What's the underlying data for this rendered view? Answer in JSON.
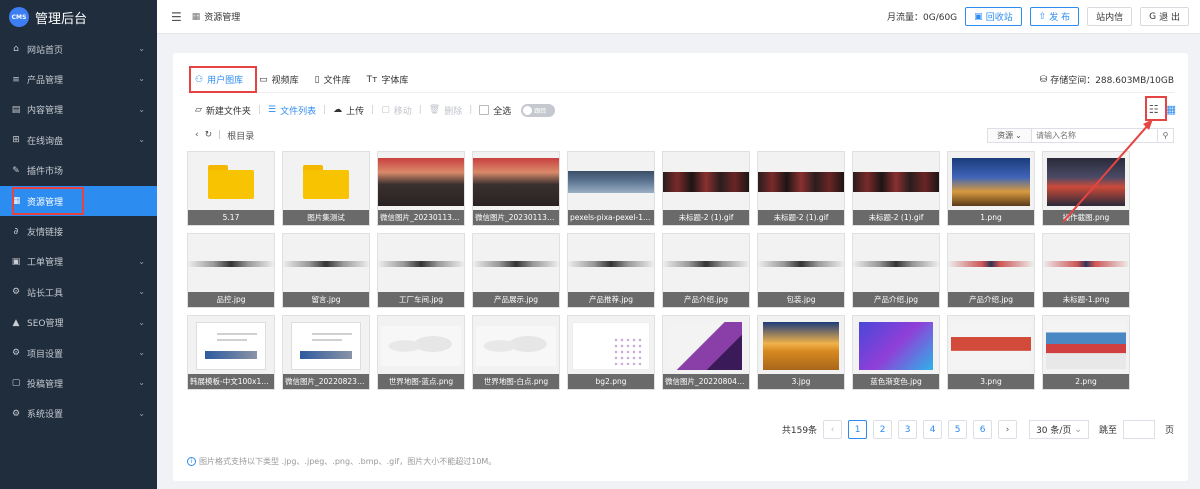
{
  "sidebar": {
    "logo_badge": "CMS",
    "logo_text": "管理后台",
    "items": [
      {
        "label": "网站首页",
        "icon": "home-icon",
        "chev": "⌄"
      },
      {
        "label": "产品管理",
        "icon": "list-icon",
        "chev": "⌄"
      },
      {
        "label": "内容管理",
        "icon": "document-icon",
        "chev": "⌄"
      },
      {
        "label": "在线询盘",
        "icon": "inquiry-icon",
        "chev": "⌄"
      },
      {
        "label": "插件市场",
        "icon": "plugin-icon",
        "chev": ""
      },
      {
        "label": "资源管理",
        "icon": "resource-icon",
        "chev": "",
        "active": true
      },
      {
        "label": "友情链接",
        "icon": "link-icon",
        "chev": ""
      },
      {
        "label": "工单管理",
        "icon": "ticket-icon",
        "chev": "⌄"
      },
      {
        "label": "站长工具",
        "icon": "tools-icon",
        "chev": "⌄"
      },
      {
        "label": "SEO管理",
        "icon": "seo-icon",
        "chev": "⌄"
      },
      {
        "label": "项目设置",
        "icon": "settings-icon",
        "chev": "⌄"
      },
      {
        "label": "投稿管理",
        "icon": "submission-icon",
        "chev": "⌄"
      },
      {
        "label": "系统设置",
        "icon": "gear-icon",
        "chev": "⌄"
      }
    ]
  },
  "topbar": {
    "breadcrumb": "资源管理",
    "traffic": "月流量：0G/60G",
    "recycle_label": "回收站",
    "publish_label": "发 布",
    "messages_label": "站内信",
    "logout_label": "退 出"
  },
  "tabs": [
    {
      "label": "用户图库",
      "icon": "user-icon"
    },
    {
      "label": "视频库",
      "icon": "video-icon"
    },
    {
      "label": "文件库",
      "icon": "file-icon"
    },
    {
      "label": "字体库",
      "icon": "font-icon"
    }
  ],
  "storage": "存储空间：288.603MB/10GB",
  "toolbar": {
    "new_folder": "新建文件夹",
    "file_list": "文件列表",
    "upload": "上传",
    "move": "移动",
    "delete": "删除",
    "select_all": "全选",
    "switch_text": "跟踪"
  },
  "path": {
    "root": "根目录"
  },
  "search": {
    "select": "资源",
    "placeholder": "请输入名称"
  },
  "files": [
    {
      "name": "5.17",
      "kind": "folder"
    },
    {
      "name": "图片集测试",
      "kind": "folder"
    },
    {
      "name": "微信图片_20230113172...",
      "kind": "crowd"
    },
    {
      "name": "微信图片_20230113171...",
      "kind": "crowd"
    },
    {
      "name": "pexels-pixa-pexel-1161...",
      "kind": "strip"
    },
    {
      "name": "未标题-2 (1).gif",
      "kind": "gif"
    },
    {
      "name": "未标题-2 (1).gif",
      "kind": "gif"
    },
    {
      "name": "未标题-2 (1).gif",
      "kind": "gif"
    },
    {
      "name": "1.png",
      "kind": "city"
    },
    {
      "name": "操作截图.png",
      "kind": "shot"
    },
    {
      "name": "品控.jpg",
      "kind": "banner"
    },
    {
      "name": "留言.jpg",
      "kind": "banner"
    },
    {
      "name": "工厂车间.jpg",
      "kind": "banner"
    },
    {
      "name": "产品展示.jpg",
      "kind": "banner"
    },
    {
      "name": "产品推荐.jpg",
      "kind": "banner"
    },
    {
      "name": "产品介绍.jpg",
      "kind": "banner"
    },
    {
      "name": "包装.jpg",
      "kind": "banner"
    },
    {
      "name": "产品介绍.jpg",
      "kind": "banner"
    },
    {
      "name": "产品介绍.jpg",
      "kind": "bannerred"
    },
    {
      "name": "未标题-1.png",
      "kind": "bannerred"
    },
    {
      "name": "韩展模板-中文100x100...",
      "kind": "doc"
    },
    {
      "name": "微信图片_20220823160...",
      "kind": "doc"
    },
    {
      "name": "世界地图-蓝点.png",
      "kind": "map"
    },
    {
      "name": "世界地图-白点.png",
      "kind": "map"
    },
    {
      "name": "bg2.png",
      "kind": "bg2"
    },
    {
      "name": "微信图片_20220804135...",
      "kind": "phone"
    },
    {
      "name": "3.jpg",
      "kind": "wheat"
    },
    {
      "name": "蓝色渐变色.jpg",
      "kind": "gradient"
    },
    {
      "name": "3.png",
      "kind": "web3"
    },
    {
      "name": "2.png",
      "kind": "web2"
    }
  ],
  "pagination": {
    "total": "共159条",
    "pages": [
      "1",
      "2",
      "3",
      "4",
      "5",
      "6"
    ],
    "current": 1,
    "page_size": "30 条/页",
    "jump_label": "跳至",
    "page_unit": "页"
  },
  "note": "图片格式支持以下类型 .jpg、.jpeg、.png、.bmp、.gif，图片大小不能超过10M。",
  "colors": {
    "accent": "#2d8cf0",
    "sidebar_bg": "#1f2d3d",
    "highlight": "#e64343",
    "folder": "#f8c300"
  }
}
